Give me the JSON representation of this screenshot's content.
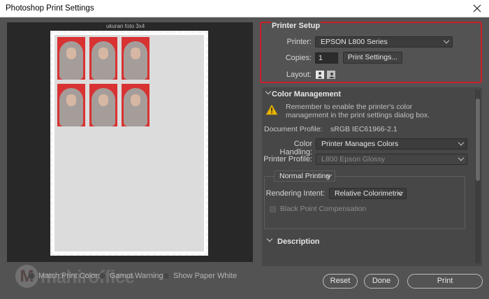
{
  "window": {
    "title": "Photoshop Print Settings"
  },
  "preview": {
    "header_text": "ukuran foto 3x4",
    "photo_rows": 2,
    "photo_cols": 3
  },
  "watermark": {
    "logo_letter": "M",
    "text": "mahiroffice"
  },
  "bottom_options": {
    "match_print_colors": "Match Print Colors",
    "gamut_warning": "Gamut Warning",
    "show_paper_white": "Show Paper White"
  },
  "printer_setup": {
    "legend": "Printer Setup",
    "printer_label": "Printer:",
    "printer_value": "EPSON L800 Series",
    "copies_label": "Copies:",
    "copies_value": "1",
    "print_settings_button": "Print Settings...",
    "layout_label": "Layout:",
    "layout_icons": [
      "portrait-icon",
      "landscape-icon"
    ]
  },
  "color_management": {
    "title": "Color Management",
    "warning_line1": "Remember to enable the printer's color",
    "warning_line2": "management in the print settings dialog box.",
    "doc_profile_label": "Document Profile:",
    "doc_profile_value": "sRGB IEC61966-2.1",
    "color_handling_label": "Color Handling:",
    "color_handling_value": "Printer Manages Colors",
    "printer_profile_label": "Printer Profile:",
    "printer_profile_value": "L800 Epson Glossy",
    "normal_printing": "Normal Printing",
    "rendering_intent_label": "Rendering Intent:",
    "rendering_intent_value": "Relative Colorimetric",
    "black_point": "Black Point Compensation"
  },
  "description": {
    "title": "Description"
  },
  "buttons": {
    "reset": "Reset",
    "done": "Done",
    "print": "Print"
  },
  "colors": {
    "highlight": "#cc1f2b",
    "photo_background": "#d83232"
  }
}
